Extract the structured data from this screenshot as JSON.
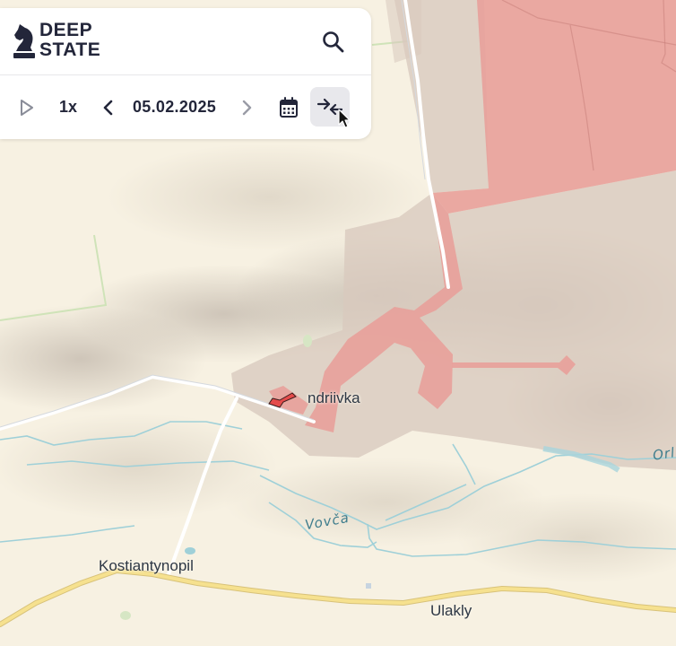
{
  "brand": {
    "line1": "DEEP",
    "line2": "STATE"
  },
  "controls": {
    "speed": "1x",
    "date": "05.02.2025"
  },
  "icons": {
    "logo": "knight-chess-icon",
    "search": "search-icon",
    "play": "play-icon",
    "prev": "chevron-left-icon",
    "next": "chevron-right-icon",
    "calendar": "calendar-icon",
    "compare": "compare-arrows-icon"
  },
  "map": {
    "labels": {
      "andriivka": "ndriivka",
      "kostiantynopil": "Kostiantynopil",
      "ulakly": "Ulakly",
      "vovcha": "Vovča",
      "orl": "Orl"
    },
    "colors": {
      "background": "#f7f1e2",
      "occupied": "#e8a09a",
      "contested": "#d8c9be",
      "road_major": "#f2d97a",
      "road_minor": "#ffffff",
      "river": "#9fd0d8"
    }
  }
}
